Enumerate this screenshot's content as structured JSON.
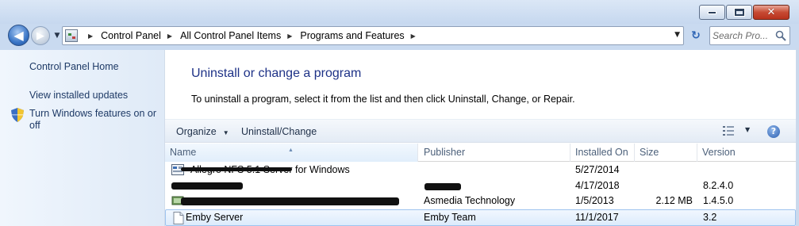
{
  "window": {
    "caption_buttons": {
      "minimize": "minimize-icon",
      "maximize": "maximize-icon",
      "close": "✕"
    }
  },
  "navigation": {
    "back_glyph": "◀",
    "forward_glyph": "▶",
    "history_glyph": "▼",
    "breadcrumbs": [
      "Control Panel",
      "All Control Panel Items",
      "Programs and Features"
    ],
    "separator": "▶",
    "dropdown_glyph": "▼",
    "refresh_glyph": "↻"
  },
  "search": {
    "placeholder": "Search Pro..."
  },
  "sidebar": {
    "items": [
      {
        "label": "Control Panel Home"
      },
      {
        "label": "View installed updates"
      },
      {
        "label": "Turn Windows features on or off",
        "icon": "shield-icon"
      }
    ]
  },
  "main": {
    "title": "Uninstall or change a program",
    "description": "To uninstall a program, select it from the list and then click Uninstall, Change, or Repair."
  },
  "toolbar": {
    "organize_label": "Organize",
    "uninstall_label": "Uninstall/Change",
    "caret": "▼",
    "help_glyph": "?"
  },
  "table": {
    "columns": [
      "Name",
      "Publisher",
      "Installed On",
      "Size",
      "Version"
    ],
    "sort_indicator": "▲",
    "rows": [
      {
        "name": "Allegro NFS 5.1 Server for Windows",
        "publisher": "",
        "installed_on": "5/27/2014",
        "size": "",
        "version": "",
        "redacted_name": true,
        "redacted_publisher": false
      },
      {
        "name": "",
        "publisher": "",
        "installed_on": "4/17/2018",
        "size": "",
        "version": "8.2.4.0",
        "redacted_name": true,
        "redacted_publisher": true
      },
      {
        "name": "",
        "publisher": "Asmedia Technology",
        "installed_on": "1/5/2013",
        "size": "2.12 MB",
        "version": "1.4.5.0",
        "redacted_name": true,
        "redacted_publisher": false
      },
      {
        "name": "Emby Server",
        "publisher": "Emby Team",
        "installed_on": "11/1/2017",
        "size": "",
        "version": "3.2",
        "selected": true
      }
    ]
  },
  "colors": {
    "title_blue": "#1e3287",
    "link_blue": "#1e3a66",
    "selection": "#dcebfc"
  }
}
